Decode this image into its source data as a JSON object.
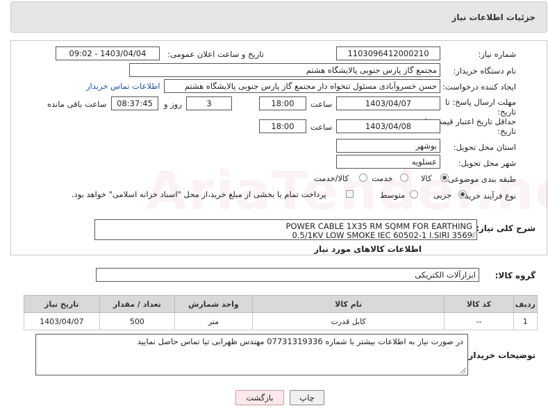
{
  "header": {
    "title": "جزئیات اطلاعات نیاز"
  },
  "form": {
    "need_number_label": "شماره نیاز:",
    "need_number": "1103096412000210",
    "announce_label": "تاریخ و ساعت اعلان عمومی:",
    "announce_value": "1403/04/04 - 09:02",
    "buyer_org_label": "نام دستگاه خریدار:",
    "buyer_org": "مجتمع گاز پارس جنوبی  پالایشگاه هشتم",
    "creator_label": "ایجاد کننده درخواست:",
    "creator": "حسن خسروآبادی مسئول تنخواه دار مجتمع گاز پارس جنوبی  پالایشگاه هشتم",
    "buyer_contact_link": "اطلاعات تماس خریدار",
    "reply_deadline_label_1": "مهلت ارسال پاسخ: تا",
    "reply_deadline_label_2": "تاریخ:",
    "reply_date": "1403/04/07",
    "time_label": "ساعت",
    "reply_time": "18:00",
    "days_value": "3",
    "days_label": "روز و",
    "remaining_time": "08:37:45",
    "remaining_label": "ساعت باقی مانده",
    "price_validity_label_1": "حداقل تاریخ اعتبار قیمت: تا",
    "price_validity_label_2": "تاریخ:",
    "price_date": "1403/04/08",
    "price_time_label": "ساعت",
    "price_time": "18:00",
    "province_label": "استان محل تحویل:",
    "province": "بوشهر",
    "city_label": "شهر محل تحویل:",
    "city": "عسلویه",
    "category_label": "طبقه بندی موضوعی:",
    "category_options": [
      "کالا",
      "خدمت",
      "کالا/خدمت"
    ],
    "process_label": "نوع فرآیند خرید :",
    "process_options": [
      "جزیی",
      "متوسط"
    ],
    "payment_note": "پرداخت تمام یا بخشی از مبلغ خرید،از محل \"اسناد خزانه اسلامی\" خواهد بود."
  },
  "description": {
    "label": "شرح کلی نیاز:",
    "line1": "POWER CABLE 1X35 RM SQMM FOR EARTHING",
    "line2": "0.5/1KV LOW SMOKE IEC 60502-1 I.SIRI 3569"
  },
  "goods": {
    "section_title": "اطلاعات کالاهای مورد نیاز",
    "group_label": "گروه کالا:",
    "group_value": "ابزارآلات الکتریکی",
    "columns": [
      "ردیف",
      "کد کالا",
      "نام کالا",
      "واحد شمارش",
      "تعداد / مقدار",
      "تاریخ نیاز"
    ],
    "rows": [
      [
        "1",
        "--",
        "کابل قدرت",
        "متر",
        "500",
        "1403/04/07"
      ]
    ]
  },
  "buyer_notes": {
    "label": "توضیحات خریدار:",
    "text": "در صورت نیاز به اطلاعات بیشتر با شماره 07731319336  مهندس ظهرابی تیا تماس حاصل نمایید"
  },
  "buttons": {
    "print": "چاپ",
    "back": "بازگشت"
  },
  "watermark_text": "AriaTender.neT"
}
